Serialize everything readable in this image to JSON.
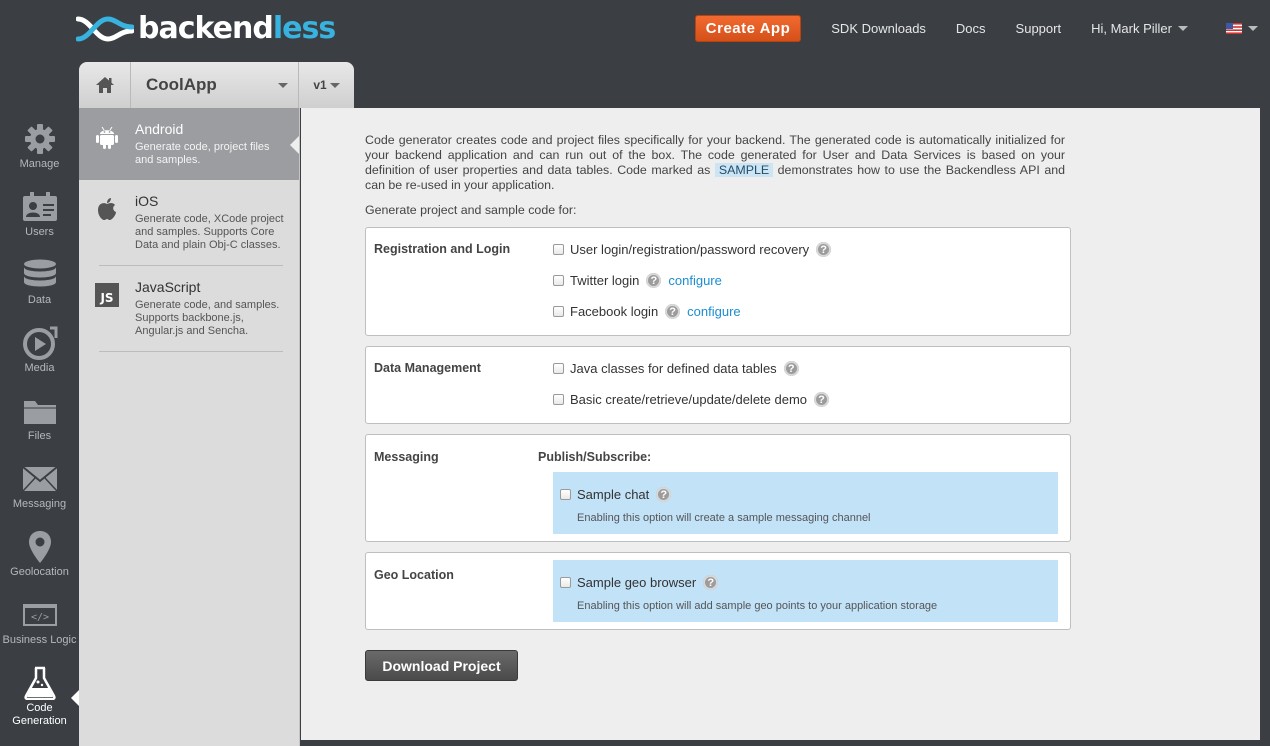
{
  "brand": {
    "name_prefix": "backend",
    "name_suffix": "less",
    "accent": "#38b3e0"
  },
  "topnav": {
    "create_label": "Create App",
    "sdk_label": "SDK Downloads",
    "docs_label": "Docs",
    "support_label": "Support",
    "user_label": "Hi, Mark Piller",
    "create_color": "#e85b22"
  },
  "app": {
    "name": "CoolApp",
    "version": "v1"
  },
  "rail": {
    "manage": "Manage",
    "users": "Users",
    "data": "Data",
    "media": "Media",
    "files": "Files",
    "messaging": "Messaging",
    "geolocation": "Geolocation",
    "business_logic": "Business Logic",
    "code_generation": "Code Generation"
  },
  "platforms": [
    {
      "title": "Android",
      "desc": "Generate code, project files and samples.",
      "icon": "android-icon"
    },
    {
      "title": "iOS",
      "desc": "Generate code, XCode project and samples. Supports Core Data and plain Obj-C classes.",
      "icon": "apple-icon"
    },
    {
      "title": "JavaScript",
      "desc": "Generate code, and samples. Supports backbone.js, Angular.js and Sencha.",
      "icon": "javascript-icon"
    }
  ],
  "intro": {
    "before": "Code generator creates code and project files specifically for your backend. The generated code is automatically initialized for your backend application and can run out of the box. The code generated for User and Data Services is based on your definition of user properties and data tables. Code marked as ",
    "tag": "SAMPLE",
    "after": " demonstrates how to use the Backendless API and can be re-used in your application."
  },
  "generate_for": "Generate project and sample code for:",
  "sections": {
    "registration": {
      "title": "Registration and Login",
      "opt1": "User login/registration/password recovery",
      "opt2": "Twitter login",
      "opt3": "Facebook login",
      "configure": "configure"
    },
    "data": {
      "title": "Data Management",
      "opt1": "Java classes for defined data tables",
      "opt2": "Basic create/retrieve/update/delete demo"
    },
    "messaging": {
      "title": "Messaging",
      "subhead": "Publish/Subscribe:",
      "opt": "Sample chat",
      "desc": "Enabling this option will create a sample messaging channel"
    },
    "geo": {
      "title": "Geo Location",
      "opt": "Sample geo browser",
      "desc": "Enabling this option will add sample geo points to your application storage"
    }
  },
  "download_label": "Download Project"
}
